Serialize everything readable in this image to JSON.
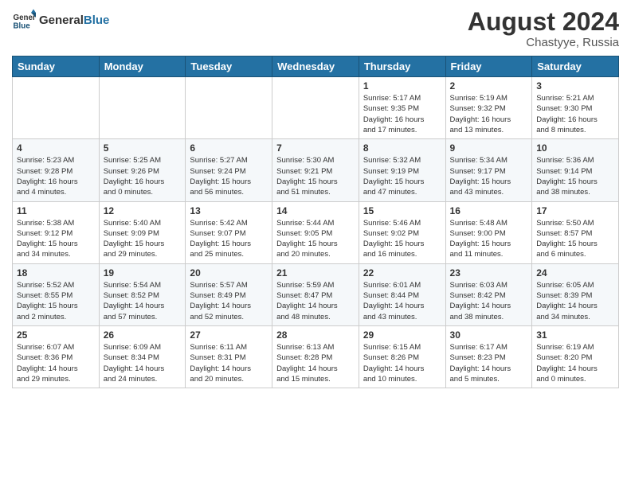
{
  "header": {
    "logo_general": "General",
    "logo_blue": "Blue",
    "month_year": "August 2024",
    "location": "Chastyye, Russia"
  },
  "weekdays": [
    "Sunday",
    "Monday",
    "Tuesday",
    "Wednesday",
    "Thursday",
    "Friday",
    "Saturday"
  ],
  "weeks": [
    [
      {
        "day": "",
        "info": ""
      },
      {
        "day": "",
        "info": ""
      },
      {
        "day": "",
        "info": ""
      },
      {
        "day": "",
        "info": ""
      },
      {
        "day": "1",
        "info": "Sunrise: 5:17 AM\nSunset: 9:35 PM\nDaylight: 16 hours\nand 17 minutes."
      },
      {
        "day": "2",
        "info": "Sunrise: 5:19 AM\nSunset: 9:32 PM\nDaylight: 16 hours\nand 13 minutes."
      },
      {
        "day": "3",
        "info": "Sunrise: 5:21 AM\nSunset: 9:30 PM\nDaylight: 16 hours\nand 8 minutes."
      }
    ],
    [
      {
        "day": "4",
        "info": "Sunrise: 5:23 AM\nSunset: 9:28 PM\nDaylight: 16 hours\nand 4 minutes."
      },
      {
        "day": "5",
        "info": "Sunrise: 5:25 AM\nSunset: 9:26 PM\nDaylight: 16 hours\nand 0 minutes."
      },
      {
        "day": "6",
        "info": "Sunrise: 5:27 AM\nSunset: 9:24 PM\nDaylight: 15 hours\nand 56 minutes."
      },
      {
        "day": "7",
        "info": "Sunrise: 5:30 AM\nSunset: 9:21 PM\nDaylight: 15 hours\nand 51 minutes."
      },
      {
        "day": "8",
        "info": "Sunrise: 5:32 AM\nSunset: 9:19 PM\nDaylight: 15 hours\nand 47 minutes."
      },
      {
        "day": "9",
        "info": "Sunrise: 5:34 AM\nSunset: 9:17 PM\nDaylight: 15 hours\nand 43 minutes."
      },
      {
        "day": "10",
        "info": "Sunrise: 5:36 AM\nSunset: 9:14 PM\nDaylight: 15 hours\nand 38 minutes."
      }
    ],
    [
      {
        "day": "11",
        "info": "Sunrise: 5:38 AM\nSunset: 9:12 PM\nDaylight: 15 hours\nand 34 minutes."
      },
      {
        "day": "12",
        "info": "Sunrise: 5:40 AM\nSunset: 9:09 PM\nDaylight: 15 hours\nand 29 minutes."
      },
      {
        "day": "13",
        "info": "Sunrise: 5:42 AM\nSunset: 9:07 PM\nDaylight: 15 hours\nand 25 minutes."
      },
      {
        "day": "14",
        "info": "Sunrise: 5:44 AM\nSunset: 9:05 PM\nDaylight: 15 hours\nand 20 minutes."
      },
      {
        "day": "15",
        "info": "Sunrise: 5:46 AM\nSunset: 9:02 PM\nDaylight: 15 hours\nand 16 minutes."
      },
      {
        "day": "16",
        "info": "Sunrise: 5:48 AM\nSunset: 9:00 PM\nDaylight: 15 hours\nand 11 minutes."
      },
      {
        "day": "17",
        "info": "Sunrise: 5:50 AM\nSunset: 8:57 PM\nDaylight: 15 hours\nand 6 minutes."
      }
    ],
    [
      {
        "day": "18",
        "info": "Sunrise: 5:52 AM\nSunset: 8:55 PM\nDaylight: 15 hours\nand 2 minutes."
      },
      {
        "day": "19",
        "info": "Sunrise: 5:54 AM\nSunset: 8:52 PM\nDaylight: 14 hours\nand 57 minutes."
      },
      {
        "day": "20",
        "info": "Sunrise: 5:57 AM\nSunset: 8:49 PM\nDaylight: 14 hours\nand 52 minutes."
      },
      {
        "day": "21",
        "info": "Sunrise: 5:59 AM\nSunset: 8:47 PM\nDaylight: 14 hours\nand 48 minutes."
      },
      {
        "day": "22",
        "info": "Sunrise: 6:01 AM\nSunset: 8:44 PM\nDaylight: 14 hours\nand 43 minutes."
      },
      {
        "day": "23",
        "info": "Sunrise: 6:03 AM\nSunset: 8:42 PM\nDaylight: 14 hours\nand 38 minutes."
      },
      {
        "day": "24",
        "info": "Sunrise: 6:05 AM\nSunset: 8:39 PM\nDaylight: 14 hours\nand 34 minutes."
      }
    ],
    [
      {
        "day": "25",
        "info": "Sunrise: 6:07 AM\nSunset: 8:36 PM\nDaylight: 14 hours\nand 29 minutes."
      },
      {
        "day": "26",
        "info": "Sunrise: 6:09 AM\nSunset: 8:34 PM\nDaylight: 14 hours\nand 24 minutes."
      },
      {
        "day": "27",
        "info": "Sunrise: 6:11 AM\nSunset: 8:31 PM\nDaylight: 14 hours\nand 20 minutes."
      },
      {
        "day": "28",
        "info": "Sunrise: 6:13 AM\nSunset: 8:28 PM\nDaylight: 14 hours\nand 15 minutes."
      },
      {
        "day": "29",
        "info": "Sunrise: 6:15 AM\nSunset: 8:26 PM\nDaylight: 14 hours\nand 10 minutes."
      },
      {
        "day": "30",
        "info": "Sunrise: 6:17 AM\nSunset: 8:23 PM\nDaylight: 14 hours\nand 5 minutes."
      },
      {
        "day": "31",
        "info": "Sunrise: 6:19 AM\nSunset: 8:20 PM\nDaylight: 14 hours\nand 0 minutes."
      }
    ]
  ]
}
